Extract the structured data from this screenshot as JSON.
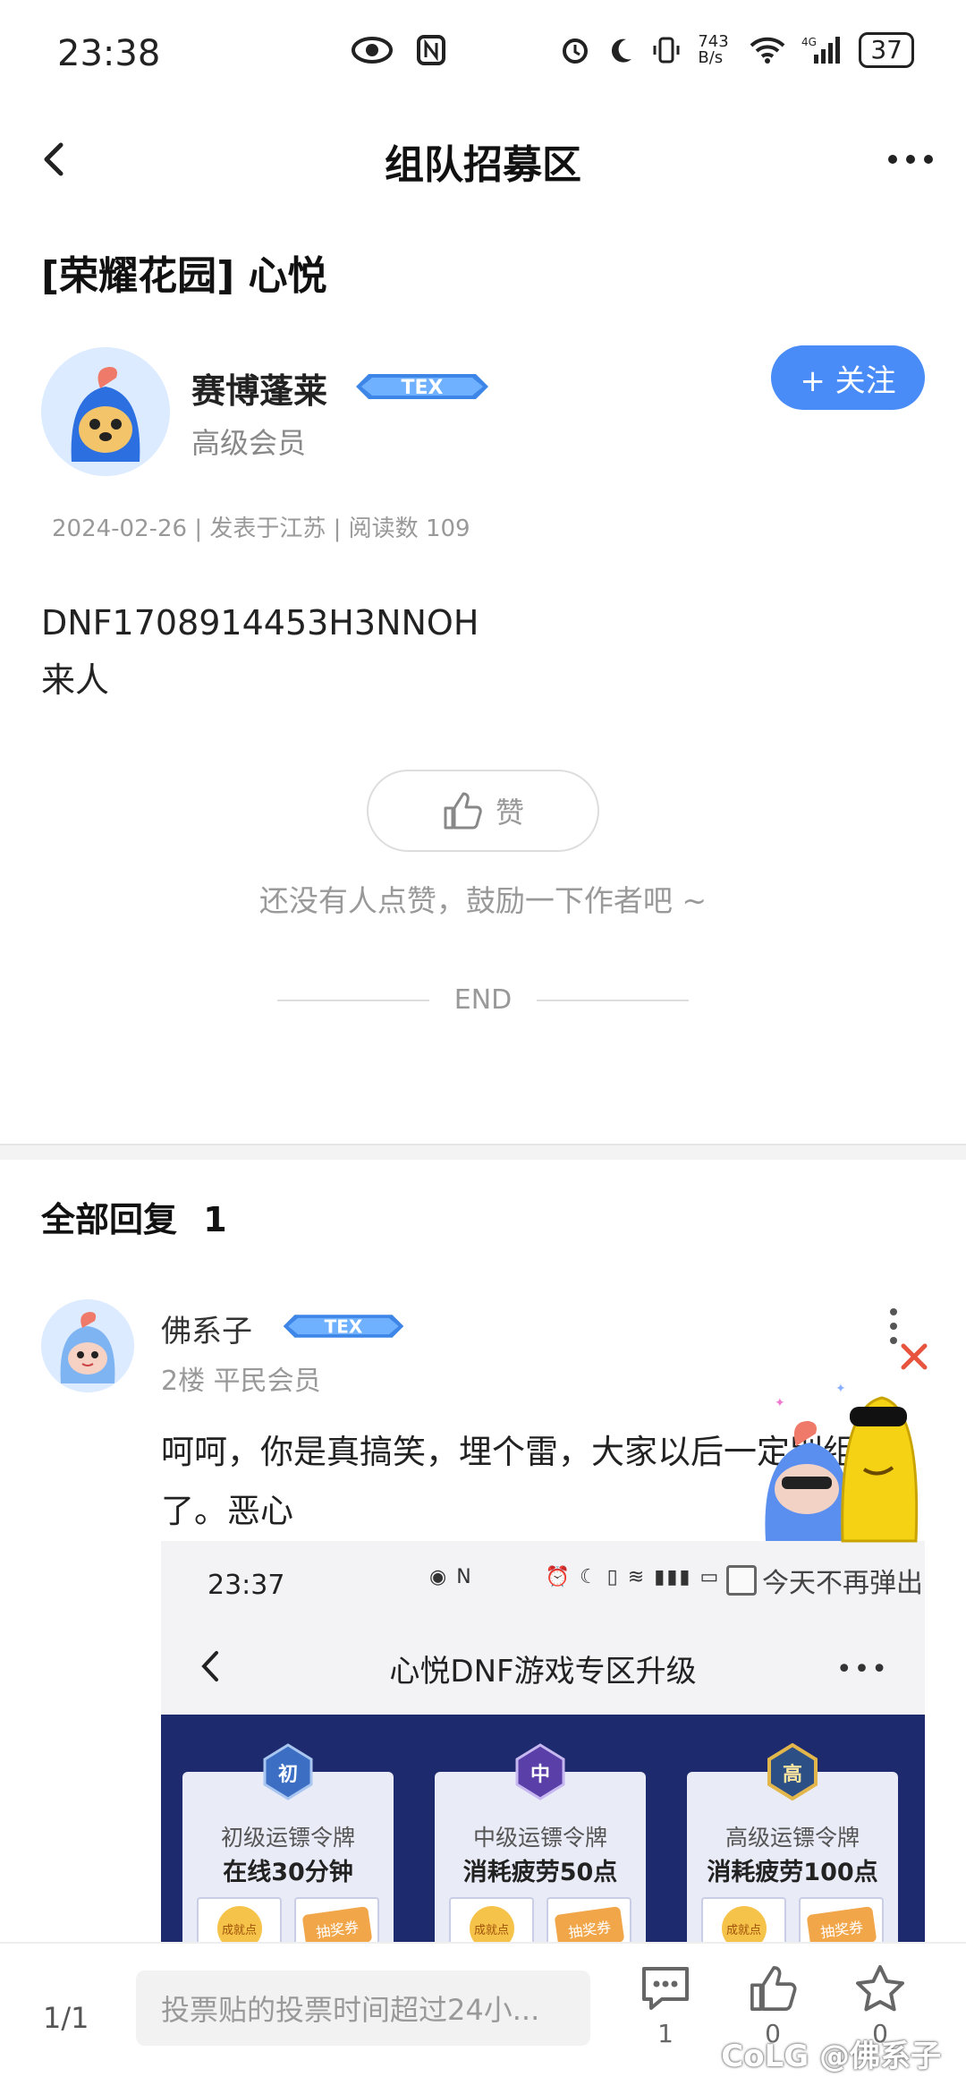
{
  "status_bar": {
    "time": "23:38",
    "net_speed": "743 B/s",
    "battery": "37"
  },
  "topbar": {
    "title": "组队招募区"
  },
  "post": {
    "title": "[荣耀花园] 心悦",
    "author": {
      "name": "赛博蓬莱",
      "level": "高级会员",
      "badge": "TEX"
    },
    "follow_label": "+ 关注",
    "meta": "2024-02-26 | 发表于江苏 | 阅读数 109",
    "body_lines": [
      "DNF1708914453H3NNOH",
      "来人"
    ],
    "like_label": "赞",
    "like_hint": "还没有人点赞，鼓励一下作者吧 ~",
    "end_label": "END"
  },
  "replies": {
    "header": "全部回复",
    "count": "1",
    "items": [
      {
        "name": "佛系子",
        "badge": "TEX",
        "meta": "2楼 平民会员",
        "text": "呵呵，你是真搞笑，埋个雷，大家以后一定别组队了。恶心"
      }
    ]
  },
  "embedded": {
    "time": "23:37",
    "title": "心悦DNF游戏专区升级",
    "tokens": [
      {
        "emblem": "初",
        "name": "初级运镖令牌",
        "req": "在线30分钟",
        "chip1": "成就点",
        "chip2": "抽奖券"
      },
      {
        "emblem": "中",
        "name": "中级运镖令牌",
        "req": "消耗疲劳50点",
        "chip1": "成就点",
        "chip2": "抽奖券"
      },
      {
        "emblem": "高",
        "name": "高级运镖令牌",
        "req": "消耗疲劳100点",
        "chip1": "成就点",
        "chip2": "抽奖券"
      }
    ]
  },
  "floating_popup": {
    "hint": "今天不再弹出"
  },
  "bottom_bar": {
    "page": "1/1",
    "input_placeholder": "投票贴的投票时间超过24小...",
    "comment_count": "1",
    "like_count": "0",
    "favorite_count": "0",
    "watermark": "CoLG @佛系子"
  },
  "colors": {
    "accent": "#4a8cf7",
    "banner": "#1e2a6e"
  }
}
